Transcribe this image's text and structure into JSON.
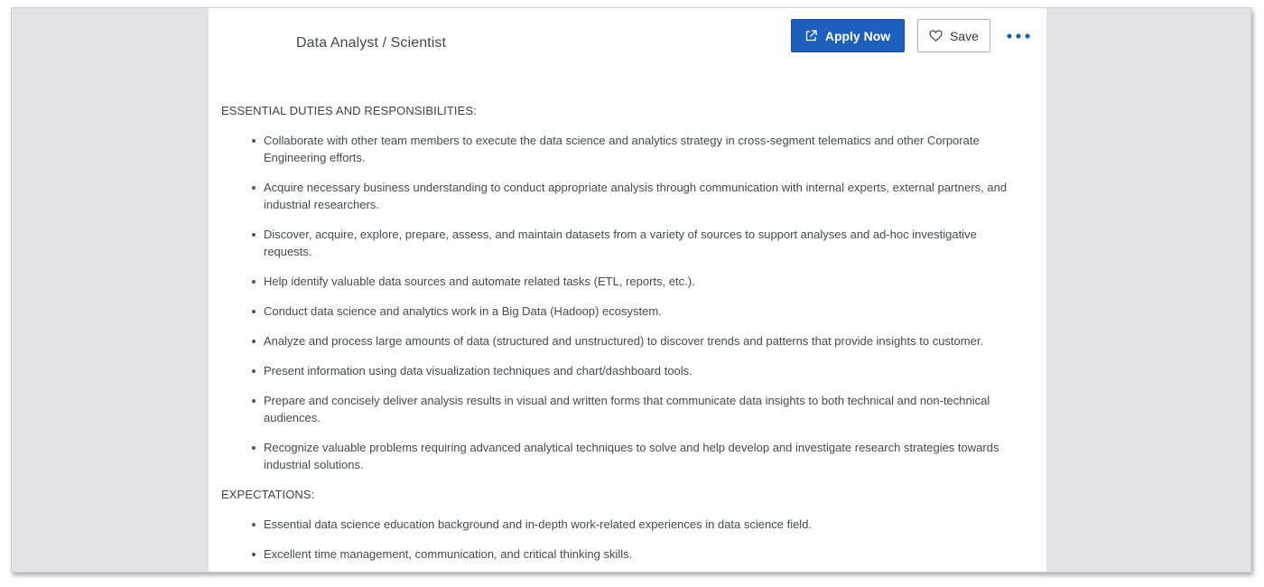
{
  "header": {
    "job_title": "Data Analyst / Scientist",
    "apply_label": "Apply Now",
    "save_label": "Save",
    "more_icon": "ellipsis-horizontal-icon",
    "apply_icon": "external-link-icon",
    "save_icon": "heart-outline-icon"
  },
  "colors": {
    "primary": "#1e5fbd",
    "text": "#444b52",
    "background": "#e2e3e6"
  },
  "sections": [
    {
      "heading": "ESSENTIAL DUTIES AND RESPONSIBILITIES:",
      "items": [
        "Collaborate with other team members to execute the data science and analytics strategy in cross-segment telematics and other Corporate Engineering efforts.",
        "Acquire necessary business understanding to conduct appropriate analysis through communication with internal experts, external partners, and industrial researchers.",
        "Discover, acquire, explore, prepare, assess, and maintain datasets from a variety of sources to support analyses and ad-hoc investigative requests.",
        "Help identify valuable data sources and automate related tasks (ETL, reports, etc.).",
        "Conduct data science and analytics work in a Big Data (Hadoop) ecosystem.",
        "Analyze and process large amounts of data (structured and unstructured) to discover trends and patterns that provide insights to customer.",
        "Present information using data visualization techniques and chart/dashboard tools.",
        "Prepare and concisely deliver analysis results in visual and written forms that communicate data insights to both technical and non-technical audiences.",
        "Recognize valuable problems requiring advanced analytical techniques to solve and help develop and investigate research strategies towards industrial solutions."
      ]
    },
    {
      "heading": "EXPECTATIONS:",
      "items": [
        "Essential data science education background and in-depth work-related experiences in data science field.",
        "Excellent time management, communication, and critical thinking skills."
      ]
    }
  ]
}
